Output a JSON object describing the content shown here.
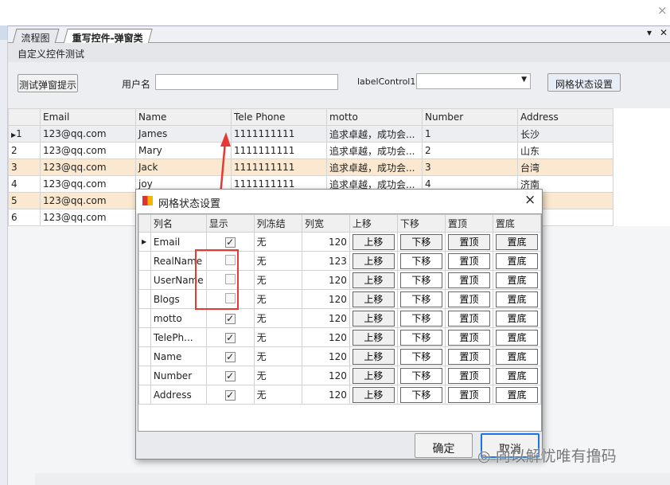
{
  "window": {
    "close_icon": "×"
  },
  "tabs": [
    {
      "label": "流程图"
    },
    {
      "label": "重写控件-弹窗类"
    }
  ],
  "tab_controls": {
    "dropdown": "▾",
    "close": "✕"
  },
  "header": {
    "title": "自定义控件测试"
  },
  "toolbar": {
    "popup_button": "测试弹窗提示",
    "username_label": "用户名",
    "username_value": "",
    "label_control": "labelControl1",
    "combo_value": "",
    "grid_settings_button": "网格状态设置"
  },
  "grid": {
    "columns": [
      "Email",
      "Name",
      "Tele Phone",
      "motto",
      "Number",
      "Address"
    ],
    "rows": [
      {
        "id": "1",
        "email": "123@qq.com",
        "name": "James",
        "phone": "1111111111",
        "motto": "追求卓越，成功会...",
        "number": "1",
        "address": "长沙"
      },
      {
        "id": "2",
        "email": "123@qq.com",
        "name": "Mary",
        "phone": "1111111111",
        "motto": "追求卓越，成功会...",
        "number": "2",
        "address": "山东"
      },
      {
        "id": "3",
        "email": "123@qq.com",
        "name": "Jack",
        "phone": "1111111111",
        "motto": "追求卓越，成功会...",
        "number": "3",
        "address": "台湾"
      },
      {
        "id": "4",
        "email": "123@qq.com",
        "name": "joy",
        "phone": "1111111111",
        "motto": "追求卓越，成功会...",
        "number": "4",
        "address": "济南"
      },
      {
        "id": "5",
        "email": "123@qq.com",
        "name": "",
        "phone": "",
        "motto": "",
        "number": "",
        "address": ""
      },
      {
        "id": "6",
        "email": "123@qq.com",
        "name": "",
        "phone": "",
        "motto": "",
        "number": "",
        "address": ""
      }
    ]
  },
  "dialog": {
    "title": "网格状态设置",
    "columns": [
      "列名",
      "显示",
      "列冻结",
      "列宽",
      "上移",
      "下移",
      "置顶",
      "置底"
    ],
    "rows": [
      {
        "name": "Email",
        "visible": true,
        "freeze": "无",
        "width": "120"
      },
      {
        "name": "RealName",
        "visible": false,
        "freeze": "无",
        "width": "123"
      },
      {
        "name": "UserName",
        "visible": false,
        "freeze": "无",
        "width": "120"
      },
      {
        "name": "Blogs",
        "visible": false,
        "freeze": "无",
        "width": "120"
      },
      {
        "name": "motto",
        "visible": true,
        "freeze": "无",
        "width": "120"
      },
      {
        "name": "TelePh...",
        "visible": true,
        "freeze": "无",
        "width": "120"
      },
      {
        "name": "Name",
        "visible": true,
        "freeze": "无",
        "width": "120"
      },
      {
        "name": "Number",
        "visible": true,
        "freeze": "无",
        "width": "120"
      },
      {
        "name": "Address",
        "visible": true,
        "freeze": "无",
        "width": "120"
      }
    ],
    "btn_up": "上移",
    "btn_down": "下移",
    "btn_top": "置顶",
    "btn_bottom": "置底",
    "ok": "确定",
    "cancel": "取消"
  },
  "watermark": "向以解忧唯有撸码"
}
